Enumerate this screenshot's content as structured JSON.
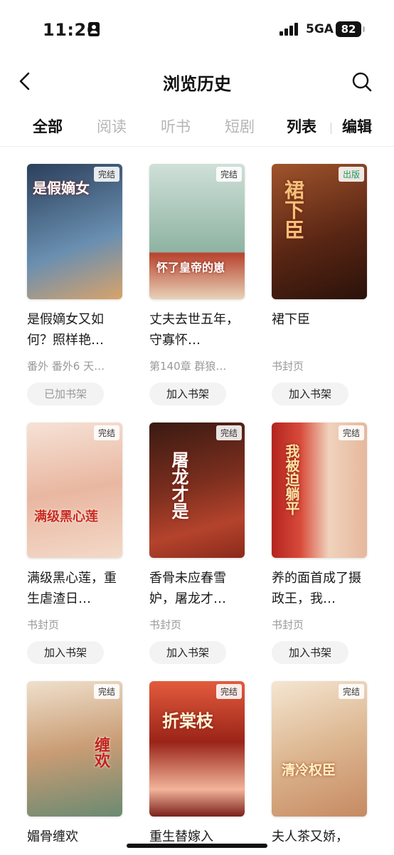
{
  "status_bar": {
    "time": "11:26",
    "network": "5GA",
    "battery": "82"
  },
  "nav": {
    "title": "浏览历史"
  },
  "tabs": {
    "all": "全部",
    "read": "阅读",
    "listen": "听书",
    "short": "短剧",
    "list": "列表",
    "edit": "编辑"
  },
  "books": [
    {
      "title": "是假嫡女又如何？照样艳…",
      "meta": "番外 番外6 天…",
      "badge": "完结",
      "button": "已加书架",
      "added": true,
      "cover_text": "是假嫡女",
      "colors": [
        "#2b3f5c",
        "#6a8fb0"
      ]
    },
    {
      "title": "丈夫去世五年，守寡怀…",
      "meta": "第140章 群狼…",
      "badge": "完结",
      "button": "加入书架",
      "added": false,
      "cover_text": "怀了皇帝的崽",
      "colors": [
        "#cfe0d8",
        "#8eb3a3"
      ]
    },
    {
      "title": "裙下臣",
      "meta": "书封页",
      "badge": "出版",
      "button": "加入书架",
      "added": false,
      "cover_text": "裙下臣",
      "colors": [
        "#7a3b22",
        "#3a1a10"
      ]
    },
    {
      "title": "满级黑心莲，重生虐渣日…",
      "meta": "书封页",
      "badge": "完结",
      "button": "加入书架",
      "added": false,
      "cover_text": "满级黑心莲",
      "colors": [
        "#f2d3c4",
        "#e09a82"
      ]
    },
    {
      "title": "香骨未应春雪妒，屠龙才…",
      "meta": "书封页",
      "badge": "完结",
      "button": "加入书架",
      "added": false,
      "cover_text": "屠龙才是",
      "colors": [
        "#5a2418",
        "#b4432c"
      ]
    },
    {
      "title": "养的面首成了摄政王，我…",
      "meta": "书封页",
      "badge": "完结",
      "button": "加入书架",
      "added": false,
      "cover_text": "我被迫躺平",
      "colors": [
        "#9e1f1f",
        "#e8c6a8"
      ]
    },
    {
      "title": "媚骨缠欢",
      "meta": "",
      "badge": "完结",
      "button": "",
      "added": false,
      "cover_text": "缠欢",
      "colors": [
        "#e4cfb9",
        "#b0805c"
      ]
    },
    {
      "title": "重生替嫁入",
      "meta": "",
      "badge": "完结",
      "button": "",
      "added": false,
      "cover_text": "折棠枝",
      "colors": [
        "#7a1f1a",
        "#e07a5a"
      ]
    },
    {
      "title": "夫人茶又娇，",
      "meta": "",
      "badge": "完结",
      "button": "",
      "added": false,
      "cover_text": "清冷权臣",
      "colors": [
        "#f0dcc4",
        "#d4a27a"
      ]
    }
  ]
}
